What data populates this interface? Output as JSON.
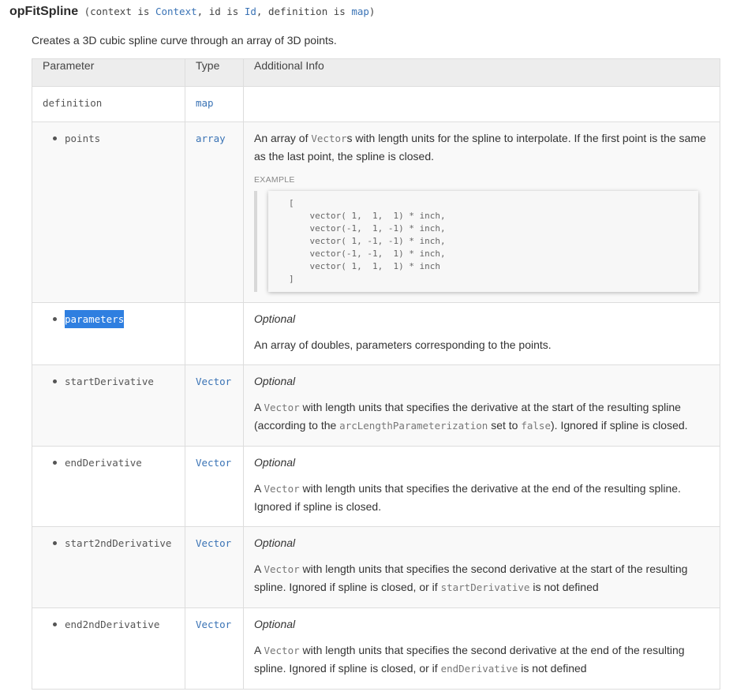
{
  "signature": {
    "name": "opFitSpline",
    "open": " (context is ",
    "context_type": "Context",
    "mid1": ", id is ",
    "id_type": "Id",
    "mid2": ", definition is ",
    "definition_type": "map",
    "close": ")"
  },
  "description": "Creates a 3D cubic spline curve through an array of 3D points.",
  "table": {
    "headers": [
      "Parameter",
      "Type",
      "Additional Info"
    ],
    "rows": {
      "definition": {
        "name": "definition",
        "type": "map"
      },
      "points": {
        "name": "points",
        "type": "array",
        "info_a": "An array of ",
        "info_code": "Vector",
        "info_b": "s with length units for the spline to interpolate. If the first point is the same as the last point, the spline is closed.",
        "example_label": "EXAMPLE",
        "example_code": "[\n    vector( 1,  1,  1) * inch,\n    vector(-1,  1, -1) * inch,\n    vector( 1, -1, -1) * inch,\n    vector(-1, -1,  1) * inch,\n    vector( 1,  1,  1) * inch\n]"
      },
      "parameters": {
        "name": "parameters",
        "optional": "Optional",
        "info": "An array of doubles, parameters corresponding to the points."
      },
      "startDerivative": {
        "name": "startDerivative",
        "type": "Vector",
        "optional": "Optional",
        "info_a": "A ",
        "info_code1": "Vector",
        "info_b": " with length units that specifies the derivative at the start of the resulting spline (according to the ",
        "info_code2": "arcLengthParameterization",
        "info_c": " set to ",
        "info_code3": "false",
        "info_d": "). Ignored if spline is closed."
      },
      "endDerivative": {
        "name": "endDerivative",
        "type": "Vector",
        "optional": "Optional",
        "info_a": "A ",
        "info_code1": "Vector",
        "info_b": " with length units that specifies the derivative at the end of the resulting spline. Ignored if spline is closed."
      },
      "start2ndDerivative": {
        "name": "start2ndDerivative",
        "type": "Vector",
        "optional": "Optional",
        "info_a": "A ",
        "info_code1": "Vector",
        "info_b": " with length units that specifies the second derivative at the start of the resulting spline. Ignored if spline is closed, or if ",
        "info_code2": "startDerivative",
        "info_c": " is not defined"
      },
      "end2ndDerivative": {
        "name": "end2ndDerivative",
        "type": "Vector",
        "optional": "Optional",
        "info_a": "A ",
        "info_code1": "Vector",
        "info_b": " with length units that specifies the second derivative at the end of the resulting spline. Ignored if spline is closed, or if ",
        "info_code2": "endDerivative",
        "info_c": " is not defined"
      }
    }
  }
}
